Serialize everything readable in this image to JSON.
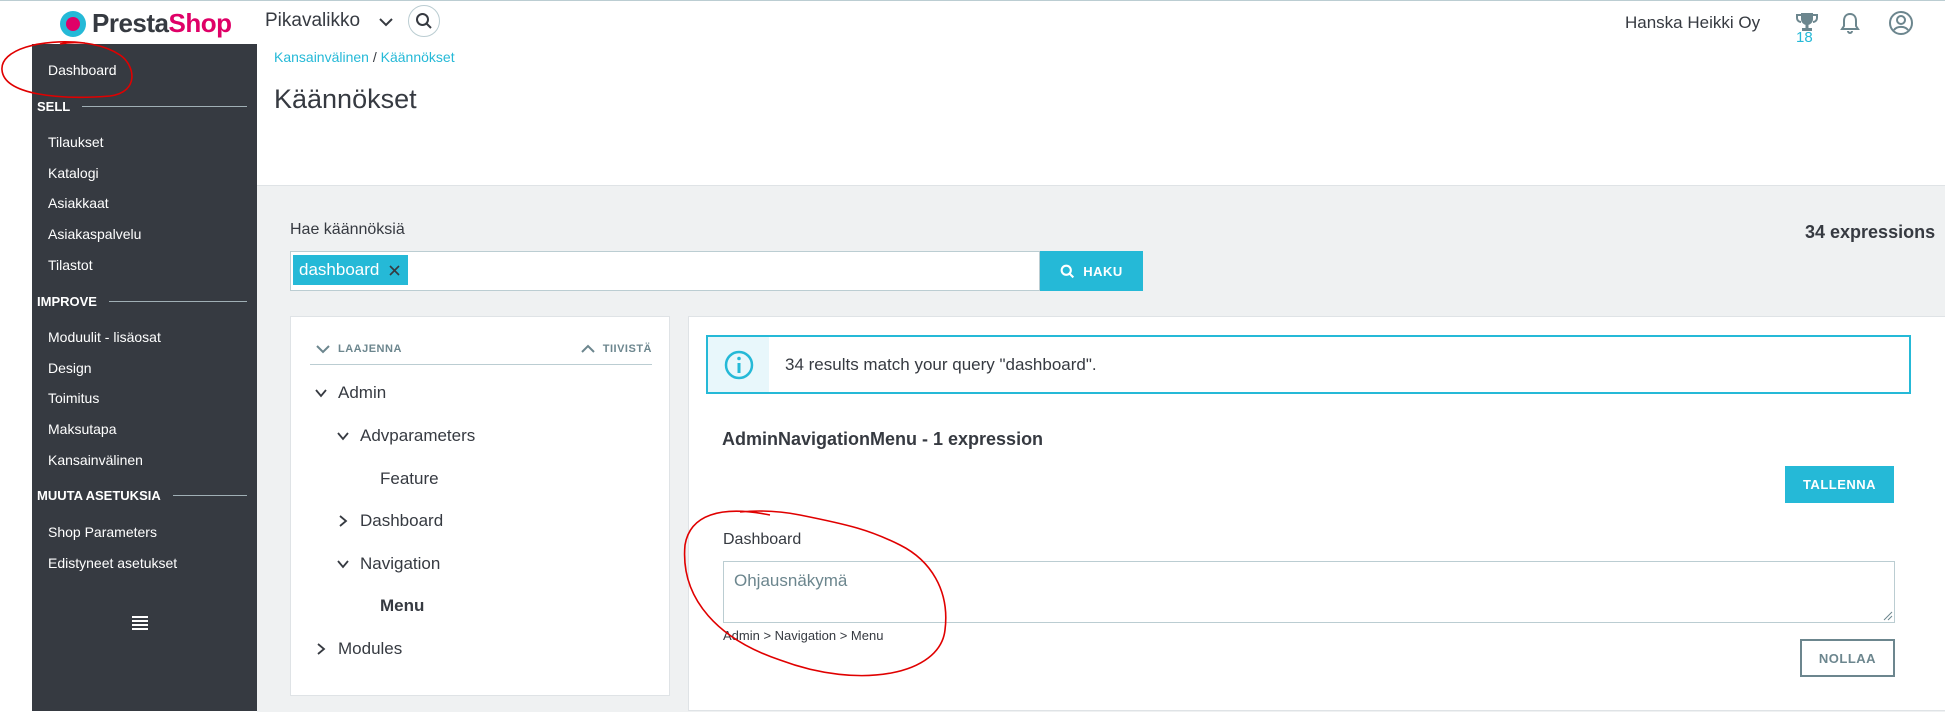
{
  "topbar": {
    "brand_part1": "Presta",
    "brand_part2": "Shop",
    "quick_access": "Pikavalikko",
    "shop_name": "Hanska Heikki Oy",
    "trophy_count": "18",
    "icons": [
      "logo-icon",
      "chevron-down-icon",
      "search-icon",
      "trophy-icon",
      "bell-icon",
      "user-icon"
    ]
  },
  "sidebar": {
    "dashboard": "Dashboard",
    "sections": [
      {
        "title": "SELL",
        "items": [
          "Tilaukset",
          "Katalogi",
          "Asiakkaat",
          "Asiakaspalvelu",
          "Tilastot"
        ]
      },
      {
        "title": "IMPROVE",
        "items": [
          "Moduulit - lisäosat",
          "Design",
          "Toimitus",
          "Maksutapa",
          "Kansainvälinen"
        ]
      },
      {
        "title": "MUUTA ASETUKSIA",
        "items": [
          "Shop Parameters",
          "Edistyneet asetukset"
        ]
      }
    ]
  },
  "header": {
    "breadcrumb": [
      "Kansainvälinen",
      "Käännökset"
    ],
    "breadcrumb_sep": "/",
    "title": "Käännökset"
  },
  "search": {
    "label": "Hae käännöksiä",
    "tag": "dashboard",
    "button": "HAKU",
    "count": "34 expressions"
  },
  "tree": {
    "expand": "LAAJENNA",
    "collapse": "TIIVISTÄ",
    "nodes": [
      {
        "label": "Admin",
        "state": "expanded"
      },
      {
        "label": "Advparameters",
        "state": "expanded"
      },
      {
        "label": "Feature",
        "state": "leaf"
      },
      {
        "label": "Dashboard",
        "state": "collapsed"
      },
      {
        "label": "Navigation",
        "state": "expanded"
      },
      {
        "label": "Menu",
        "state": "selected"
      },
      {
        "label": "Modules",
        "state": "collapsed"
      }
    ]
  },
  "results": {
    "alert": "34 results match your query \"dashboard\".",
    "domain_title": "AdminNavigationMenu - 1 expression",
    "save_button": "TALLENNA",
    "key": "Dashboard",
    "translation": "Ohjausnäkymä",
    "path": "Admin > Navigation > Menu",
    "reset_button": "NOLLAA"
  },
  "colors": {
    "accent": "#25b9d7",
    "sidebar": "#363a41",
    "brand_pink": "#df0067",
    "annotation": "#e00000"
  }
}
